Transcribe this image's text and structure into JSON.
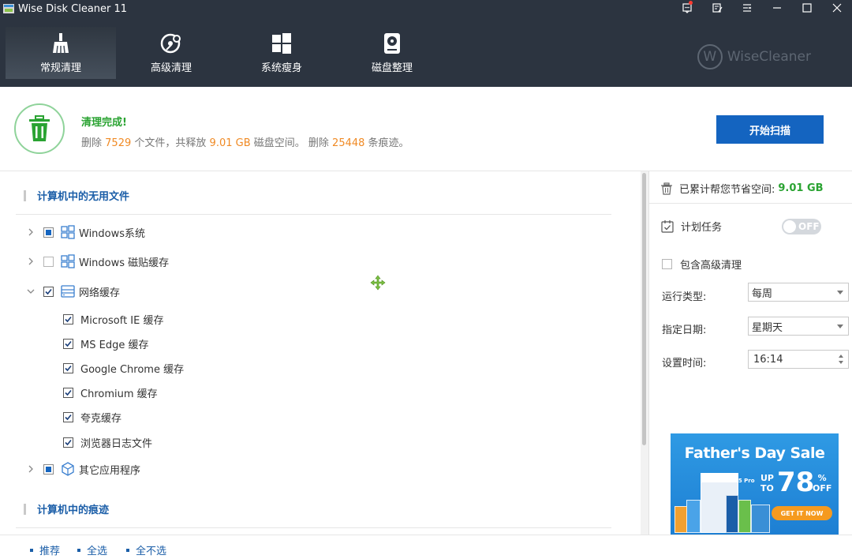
{
  "window": {
    "title": "Wise Disk Cleaner 11"
  },
  "nav": {
    "tabs": [
      {
        "label": "常规清理",
        "icon": "broom-icon",
        "active": true
      },
      {
        "label": "高级清理",
        "icon": "disk-search-icon",
        "active": false
      },
      {
        "label": "系统瘦身",
        "icon": "windows-logo-icon",
        "active": false
      },
      {
        "label": "磁盘整理",
        "icon": "disk-defrag-icon",
        "active": false
      }
    ],
    "brand": "WiseCleaner",
    "brand_mark": "W"
  },
  "status": {
    "title": "清理完成!",
    "line_prefix": "删除",
    "files_count": "7529",
    "line_mid1": "个文件，共释放",
    "freed_space": "9.01 GB",
    "line_mid2": "磁盘空间。 删除",
    "traces_count": "25448",
    "line_suffix": "条痕迹。",
    "scan_button": "开始扫描",
    "accent_color": "#2aa332",
    "number_color": "#f08a24"
  },
  "tree": {
    "section1": "计算机中的无用文件",
    "section2": "计算机中的痕迹",
    "categories": [
      {
        "label": "Windows系统",
        "state": "partial",
        "expanded": false
      },
      {
        "label": "Windows 磁贴缓存",
        "state": "unchecked",
        "expanded": false
      },
      {
        "label": "网络缓存",
        "state": "checked",
        "expanded": true
      },
      {
        "label": "其它应用程序",
        "state": "partial",
        "expanded": false
      }
    ],
    "network_children": [
      "Microsoft IE 缓存",
      "MS Edge 缓存",
      "Google Chrome 缓存",
      "Chromium 缓存",
      "夸克缓存",
      "浏览器日志文件"
    ]
  },
  "right_panel": {
    "saved_label": "已累计帮您节省空间:",
    "saved_value": "9.01 GB",
    "schedule_label": "计划任务",
    "toggle_text": "OFF",
    "include_advanced": "包含高级清理",
    "run_type_label": "运行类型:",
    "run_type_value": "每周",
    "date_label": "指定日期:",
    "date_value": "星期天",
    "time_label": "设置时间:",
    "time_value": "16:14"
  },
  "ad": {
    "title": "Father's Day Sale",
    "up": "UP",
    "to": "TO",
    "percent": "78",
    "pct_sign": "%",
    "off": "OFF",
    "button": "GET IT NOW",
    "product": "WiseCare365 Pro"
  },
  "bottom": {
    "links": [
      "推荐",
      "全选",
      "全不选"
    ]
  }
}
